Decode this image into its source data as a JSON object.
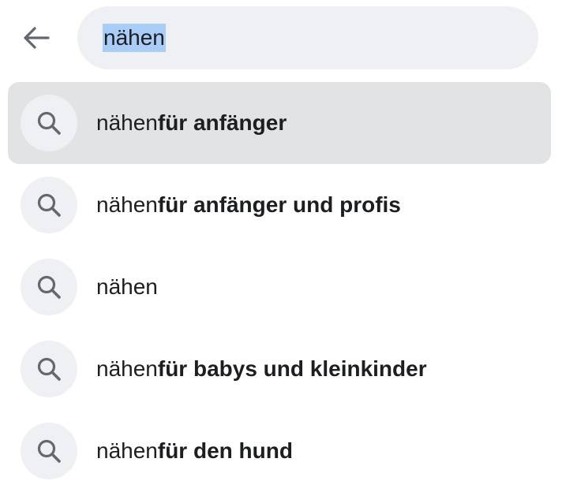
{
  "search": {
    "value": "nähen"
  },
  "suggestions": [
    {
      "prefix": "nähen",
      "suffix": "für anfänger",
      "active": true
    },
    {
      "prefix": "nähen",
      "suffix": "für anfänger und profis",
      "active": false
    },
    {
      "prefix": "nähen",
      "suffix": "",
      "active": false
    },
    {
      "prefix": "nähen",
      "suffix": "für babys und kleinkinder",
      "active": false
    },
    {
      "prefix": "nähen",
      "suffix": "für den hund",
      "active": false
    }
  ],
  "icons": {
    "back": "back-arrow-icon",
    "suggestion": "search-icon"
  },
  "colors": {
    "field_background": "#eff0f4",
    "highlight_row": "#e2e3e4",
    "text_selection": "#a9cdf7",
    "icon": "#65676b"
  }
}
